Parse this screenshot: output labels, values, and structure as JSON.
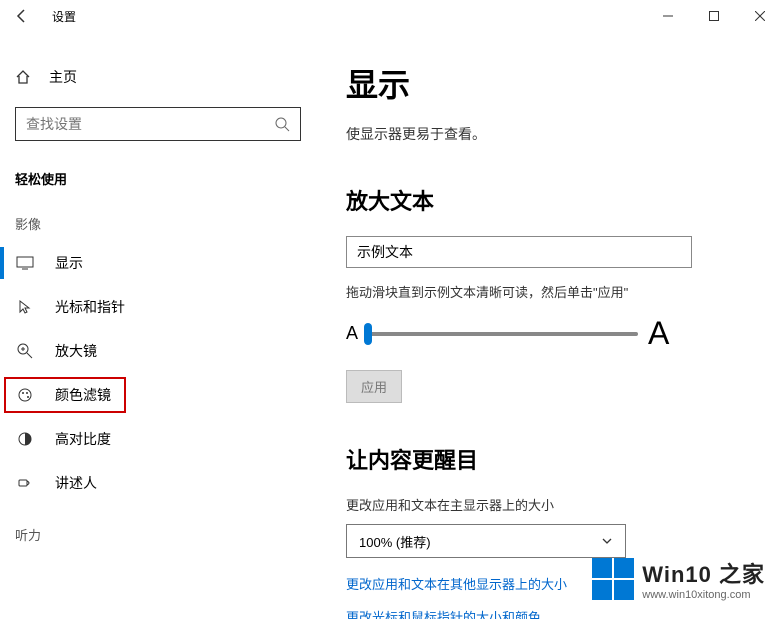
{
  "titlebar": {
    "title": "设置"
  },
  "sidebar": {
    "home": "主页",
    "search_placeholder": "查找设置",
    "category": "轻松使用",
    "grp_video": "影像",
    "items": [
      {
        "label": "显示"
      },
      {
        "label": "光标和指针"
      },
      {
        "label": "放大镜"
      },
      {
        "label": "颜色滤镜"
      },
      {
        "label": "高对比度"
      },
      {
        "label": "讲述人"
      }
    ],
    "grp_audio": "听力"
  },
  "main": {
    "h1": "显示",
    "desc": "使显示器更易于查看。",
    "h2a": "放大文本",
    "sample": "示例文本",
    "hint": "拖动滑块直到示例文本清晰可读，然后单击\"应用\"",
    "apply": "应用",
    "h2b": "让内容更醒目",
    "scale_label": "更改应用和文本在主显示器上的大小",
    "scale_value": "100% (推荐)",
    "link1": "更改应用和文本在其他显示器上的大小",
    "link2": "更改光标和鼠标指针的大小和颜色"
  },
  "watermark": {
    "title": "Win10 之家",
    "url": "www.win10xitong.com"
  }
}
